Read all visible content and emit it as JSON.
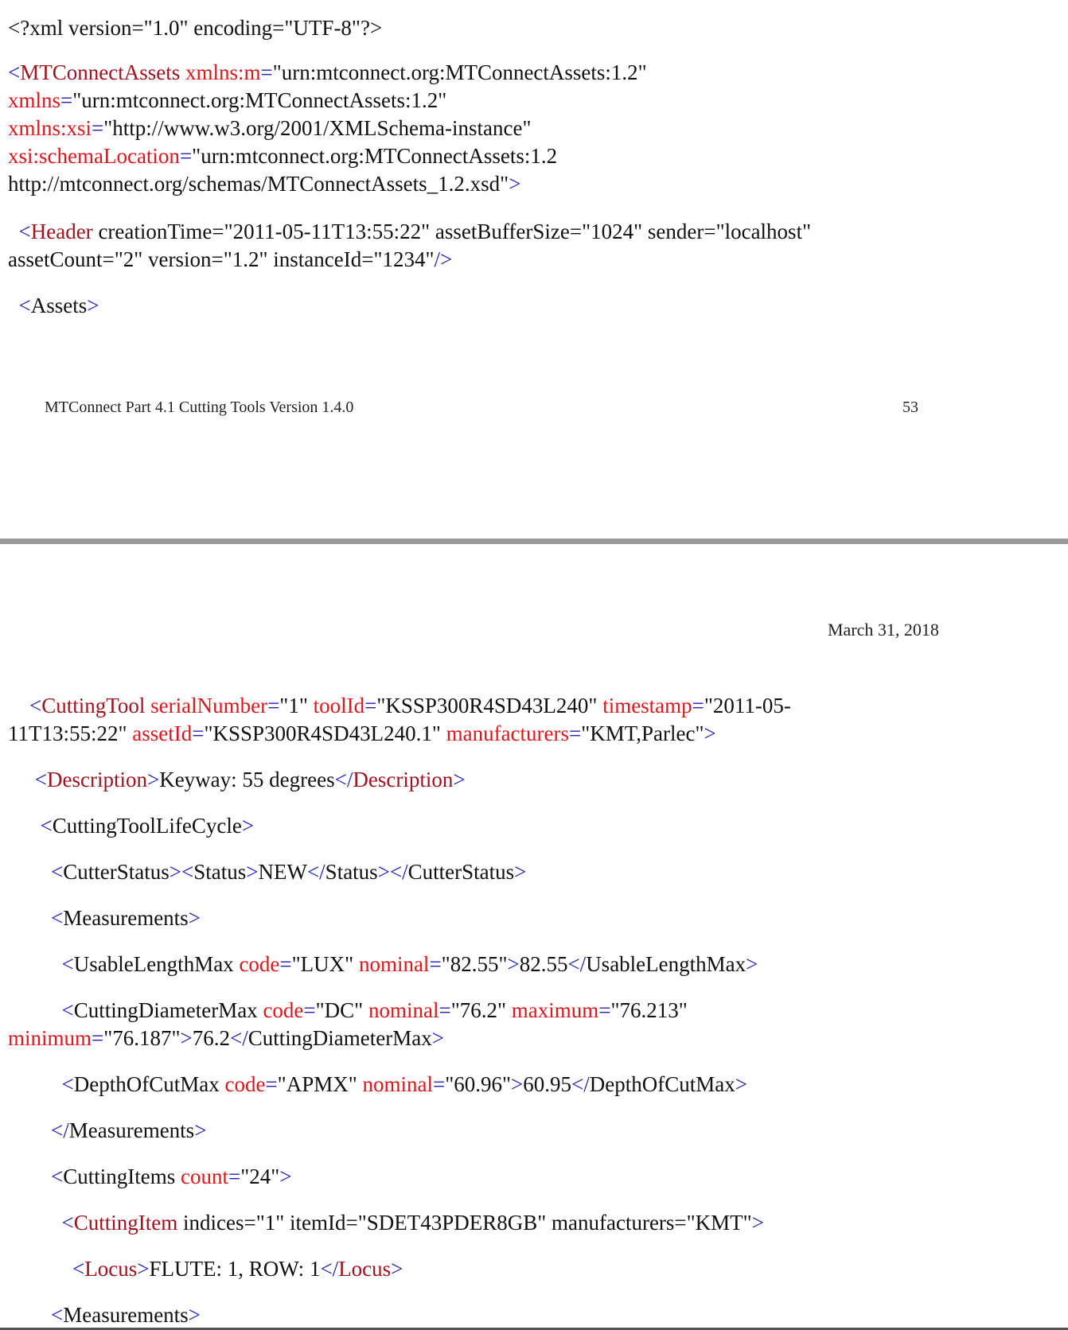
{
  "colors": {
    "tag_delimiter": "#1f1fb8",
    "element_name": "#a1121e",
    "attribute_name": "#e0161c",
    "text": "#111111",
    "page_separator": "#9a9a9a"
  },
  "page1": {
    "lines": [
      [
        {
          "k": "plain",
          "s": "<?xml version=\"1.0\" encoding=\"UTF-8\"?>"
        }
      ],
      [
        {
          "k": "t",
          "s": "<"
        },
        {
          "k": "e",
          "s": "MTConnectAssets"
        },
        {
          "k": "v",
          "s": " "
        },
        {
          "k": "a",
          "s": "xmlns:m"
        },
        {
          "k": "t",
          "s": "="
        },
        {
          "k": "v",
          "s": "\"urn:mtconnect.org:MTConnectAssets:1.2\""
        }
      ],
      [
        {
          "k": "a",
          "s": "xmlns"
        },
        {
          "k": "t",
          "s": "="
        },
        {
          "k": "v",
          "s": "\"urn:mtconnect.org:MTConnectAssets:1.2\""
        }
      ],
      [
        {
          "k": "a",
          "s": "xmlns:xsi"
        },
        {
          "k": "t",
          "s": "="
        },
        {
          "k": "v",
          "s": "\"http://www.w3.org/2001/XMLSchema-instance\""
        }
      ],
      [
        {
          "k": "a",
          "s": "xsi:schemaLocation"
        },
        {
          "k": "t",
          "s": "="
        },
        {
          "k": "v",
          "s": "\"urn:mtconnect.org:MTConnectAssets:1.2"
        }
      ],
      [
        {
          "k": "v",
          "s": "http://mtconnect.org/schemas/MTConnectAssets_1.2.xsd\""
        },
        {
          "k": "t",
          "s": ">"
        }
      ],
      [
        {
          "k": "v",
          "s": "  "
        },
        {
          "k": "t",
          "s": "<"
        },
        {
          "k": "e",
          "s": "Header"
        },
        {
          "k": "v",
          "s": " creationTime=\"2011-05-11T13:55:22\" assetBufferSize=\"1024\" sender=\"localhost\""
        }
      ],
      [
        {
          "k": "v",
          "s": "assetCount=\"2\" version=\"1.2\" instanceId=\"1234\""
        },
        {
          "k": "t",
          "s": "/>"
        }
      ],
      [
        {
          "k": "v",
          "s": "  "
        },
        {
          "k": "t",
          "s": "<"
        },
        {
          "k": "v",
          "s": "Assets"
        },
        {
          "k": "t",
          "s": ">"
        }
      ]
    ],
    "footer_left": "MTConnect Part 4.1 Cutting Tools Version 1.4.0",
    "footer_page": "53"
  },
  "page2": {
    "header_date": "March 31, 2018",
    "lines": [
      [
        {
          "k": "v",
          "s": "    "
        },
        {
          "k": "t",
          "s": "<"
        },
        {
          "k": "e",
          "s": "CuttingTool"
        },
        {
          "k": "v",
          "s": " "
        },
        {
          "k": "a",
          "s": "serialNumber"
        },
        {
          "k": "t",
          "s": "="
        },
        {
          "k": "v",
          "s": "\"1\" "
        },
        {
          "k": "a",
          "s": "toolId"
        },
        {
          "k": "t",
          "s": "="
        },
        {
          "k": "v",
          "s": "\"KSSP300R4SD43L240\" "
        },
        {
          "k": "a",
          "s": "timestamp"
        },
        {
          "k": "t",
          "s": "="
        },
        {
          "k": "v",
          "s": "\"2011-05-"
        }
      ],
      [
        {
          "k": "v",
          "s": "11T13:55:22\" "
        },
        {
          "k": "a",
          "s": "assetId"
        },
        {
          "k": "t",
          "s": "="
        },
        {
          "k": "v",
          "s": "\"KSSP300R4SD43L240.1\" "
        },
        {
          "k": "a",
          "s": "manufacturers"
        },
        {
          "k": "t",
          "s": "="
        },
        {
          "k": "v",
          "s": "\"KMT,Parlec\""
        },
        {
          "k": "t",
          "s": ">"
        }
      ],
      [
        {
          "k": "v",
          "s": "     "
        },
        {
          "k": "t",
          "s": "<"
        },
        {
          "k": "e",
          "s": "Description"
        },
        {
          "k": "t",
          "s": ">"
        },
        {
          "k": "v",
          "s": "Keyway: 55 degrees"
        },
        {
          "k": "t",
          "s": "</"
        },
        {
          "k": "e",
          "s": "Description"
        },
        {
          "k": "t",
          "s": ">"
        }
      ],
      [
        {
          "k": "v",
          "s": "      "
        },
        {
          "k": "t",
          "s": "<"
        },
        {
          "k": "v",
          "s": "CuttingToolLifeCycle"
        },
        {
          "k": "t",
          "s": ">"
        }
      ],
      [
        {
          "k": "v",
          "s": "        "
        },
        {
          "k": "t",
          "s": "<"
        },
        {
          "k": "v",
          "s": "CutterStatus"
        },
        {
          "k": "t",
          "s": "><"
        },
        {
          "k": "v",
          "s": "Status"
        },
        {
          "k": "t",
          "s": ">"
        },
        {
          "k": "v",
          "s": "NEW"
        },
        {
          "k": "t",
          "s": "</"
        },
        {
          "k": "v",
          "s": "Status"
        },
        {
          "k": "t",
          "s": "></"
        },
        {
          "k": "v",
          "s": "CutterStatus"
        },
        {
          "k": "t",
          "s": ">"
        }
      ],
      [
        {
          "k": "v",
          "s": "        "
        },
        {
          "k": "t",
          "s": "<"
        },
        {
          "k": "v",
          "s": "Measurements"
        },
        {
          "k": "t",
          "s": ">"
        }
      ],
      [
        {
          "k": "v",
          "s": "          "
        },
        {
          "k": "t",
          "s": "<"
        },
        {
          "k": "v",
          "s": "UsableLengthMax "
        },
        {
          "k": "a",
          "s": "code"
        },
        {
          "k": "t",
          "s": "="
        },
        {
          "k": "v",
          "s": "\"LUX\" "
        },
        {
          "k": "a",
          "s": "nominal"
        },
        {
          "k": "t",
          "s": "="
        },
        {
          "k": "v",
          "s": "\"82.55\""
        },
        {
          "k": "t",
          "s": ">"
        },
        {
          "k": "v",
          "s": "82.55"
        },
        {
          "k": "t",
          "s": "</"
        },
        {
          "k": "v",
          "s": "UsableLengthMax"
        },
        {
          "k": "t",
          "s": ">"
        }
      ],
      [
        {
          "k": "v",
          "s": "          "
        },
        {
          "k": "t",
          "s": "<"
        },
        {
          "k": "v",
          "s": "CuttingDiameterMax "
        },
        {
          "k": "a",
          "s": "code"
        },
        {
          "k": "t",
          "s": "="
        },
        {
          "k": "v",
          "s": "\"DC\" "
        },
        {
          "k": "a",
          "s": "nominal"
        },
        {
          "k": "t",
          "s": "="
        },
        {
          "k": "v",
          "s": "\"76.2\" "
        },
        {
          "k": "a",
          "s": "maximum"
        },
        {
          "k": "t",
          "s": "="
        },
        {
          "k": "v",
          "s": "\"76.213\""
        }
      ],
      [
        {
          "k": "a",
          "s": "minimum"
        },
        {
          "k": "t",
          "s": "="
        },
        {
          "k": "v",
          "s": "\"76.187\""
        },
        {
          "k": "t",
          "s": ">"
        },
        {
          "k": "v",
          "s": "76.2"
        },
        {
          "k": "t",
          "s": "</"
        },
        {
          "k": "v",
          "s": "CuttingDiameterMax"
        },
        {
          "k": "t",
          "s": ">"
        }
      ],
      [
        {
          "k": "v",
          "s": "          "
        },
        {
          "k": "t",
          "s": "<"
        },
        {
          "k": "v",
          "s": "DepthOfCutMax "
        },
        {
          "k": "a",
          "s": "code"
        },
        {
          "k": "t",
          "s": "="
        },
        {
          "k": "v",
          "s": "\"APMX\" "
        },
        {
          "k": "a",
          "s": "nominal"
        },
        {
          "k": "t",
          "s": "="
        },
        {
          "k": "v",
          "s": "\"60.96\""
        },
        {
          "k": "t",
          "s": ">"
        },
        {
          "k": "v",
          "s": "60.95"
        },
        {
          "k": "t",
          "s": "</"
        },
        {
          "k": "v",
          "s": "DepthOfCutMax"
        },
        {
          "k": "t",
          "s": ">"
        }
      ],
      [
        {
          "k": "v",
          "s": "        "
        },
        {
          "k": "t",
          "s": "</"
        },
        {
          "k": "v",
          "s": "Measurements"
        },
        {
          "k": "t",
          "s": ">"
        }
      ],
      [
        {
          "k": "v",
          "s": "        "
        },
        {
          "k": "t",
          "s": "<"
        },
        {
          "k": "v",
          "s": "CuttingItems "
        },
        {
          "k": "a",
          "s": "count"
        },
        {
          "k": "t",
          "s": "="
        },
        {
          "k": "v",
          "s": "\"24\""
        },
        {
          "k": "t",
          "s": ">"
        }
      ],
      [
        {
          "k": "v",
          "s": "          "
        },
        {
          "k": "t",
          "s": "<"
        },
        {
          "k": "e",
          "s": "CuttingItem"
        },
        {
          "k": "v",
          "s": " indices=\"1\" itemId=\"SDET43PDER8GB\" manufacturers=\"KMT\""
        },
        {
          "k": "t",
          "s": ">"
        }
      ],
      [
        {
          "k": "v",
          "s": "            "
        },
        {
          "k": "t",
          "s": "<"
        },
        {
          "k": "e",
          "s": "Locus"
        },
        {
          "k": "t",
          "s": ">"
        },
        {
          "k": "v",
          "s": "FLUTE: 1, ROW: 1"
        },
        {
          "k": "t",
          "s": "</"
        },
        {
          "k": "e",
          "s": "Locus"
        },
        {
          "k": "t",
          "s": ">"
        }
      ],
      [
        {
          "k": "v",
          "s": "        "
        },
        {
          "k": "t",
          "s": "<"
        },
        {
          "k": "v",
          "s": "Measurements"
        },
        {
          "k": "t",
          "s": ">"
        }
      ]
    ]
  }
}
